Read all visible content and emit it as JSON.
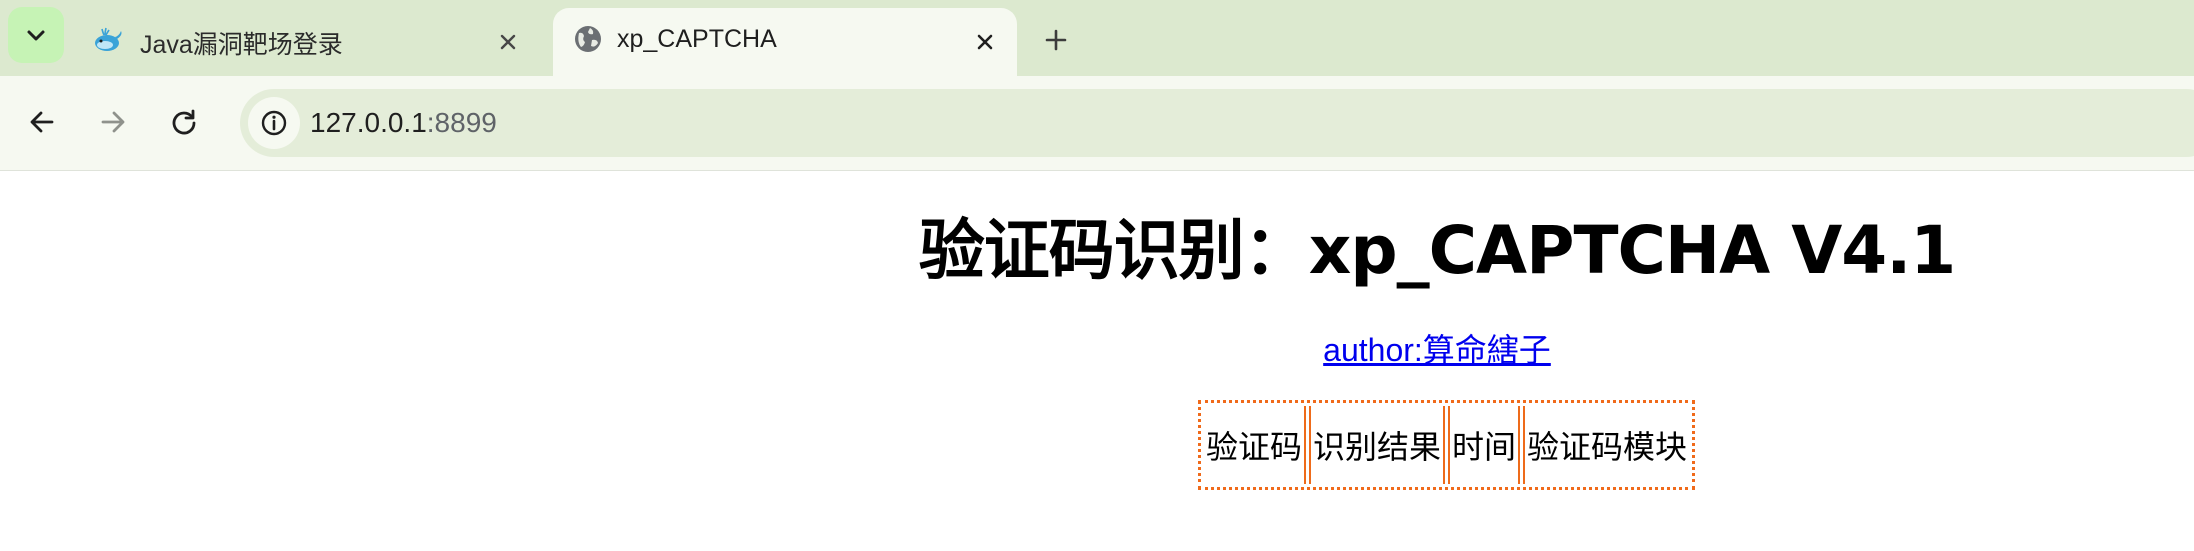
{
  "browser": {
    "tabs": [
      {
        "title": "Java漏洞靶场登录",
        "favicon": "whale-icon",
        "active": false
      },
      {
        "title": "xp_CAPTCHA",
        "favicon": "globe-icon",
        "active": true
      }
    ],
    "address_bar": {
      "host": "127.0.0.1",
      "port": ":8899"
    },
    "colors": {
      "tabbar_bg": "#dce9cf",
      "menu_btn_bg": "#c6f3b5",
      "active_tab_bg": "#f6f9f1",
      "omnibox_bg": "#e4edd9"
    }
  },
  "page": {
    "title": "验证码识别：xp_CAPTCHA V4.1",
    "author_link": "author:算命縖子",
    "table": {
      "headers": [
        "验证码",
        "识别结果",
        "时间",
        "验证码模块"
      ]
    },
    "colors": {
      "link": "#0000ee",
      "table_border": "#f06a1a"
    }
  }
}
